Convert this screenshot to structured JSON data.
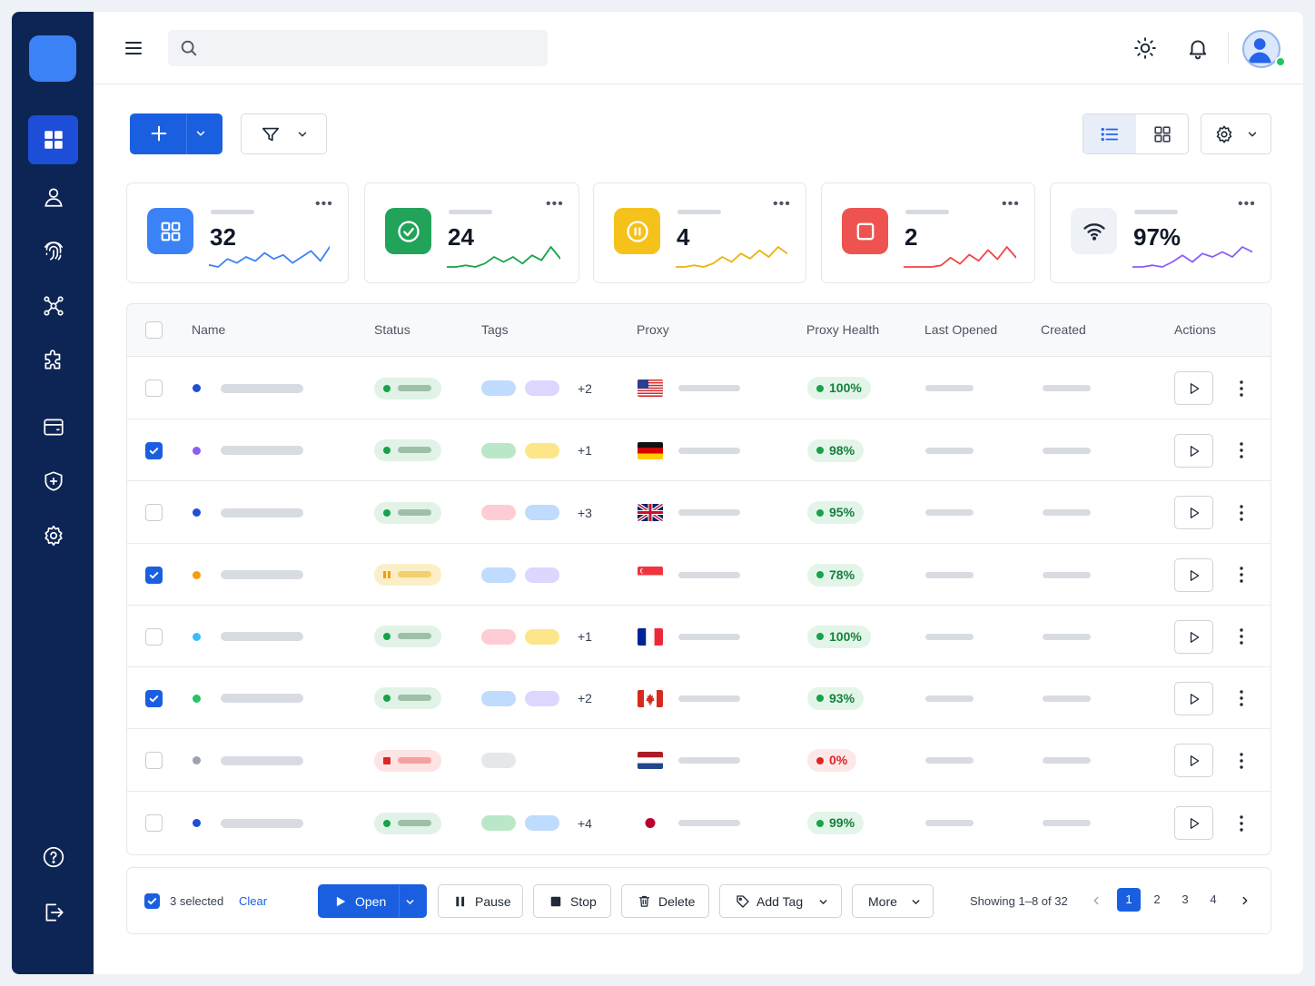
{
  "sidebar": {
    "items": [
      {
        "icon": "dashboard-icon",
        "active": true
      },
      {
        "icon": "user-icon"
      },
      {
        "icon": "fingerprint-icon"
      },
      {
        "icon": "network-icon"
      },
      {
        "icon": "puzzle-icon"
      },
      {
        "icon": "wallet-icon"
      },
      {
        "icon": "shield-plus-icon"
      },
      {
        "icon": "settings-icon"
      }
    ],
    "bottom": [
      {
        "icon": "help-icon"
      },
      {
        "icon": "logout-icon"
      }
    ]
  },
  "topbar": {
    "search_placeholder": ""
  },
  "stats": [
    {
      "value": "32",
      "icon": "grid-icon",
      "color": "#3b82f6",
      "spark": [
        4,
        3,
        7,
        5,
        8,
        6,
        10,
        7,
        9,
        5,
        8,
        11,
        6,
        13
      ]
    },
    {
      "value": "24",
      "icon": "check-circle-icon",
      "color": "#16a34a",
      "spark": [
        3,
        3,
        4,
        3,
        5,
        9,
        6,
        9,
        5,
        10,
        7,
        15,
        8
      ]
    },
    {
      "value": "4",
      "icon": "pause-circle-icon",
      "color": "#eab308",
      "spark": [
        3,
        3,
        4,
        3,
        5,
        9,
        6,
        11,
        8,
        13,
        9,
        15,
        11
      ]
    },
    {
      "value": "2",
      "icon": "stop-icon",
      "color": "#ef4444",
      "spark": [
        3,
        3,
        3,
        3,
        4,
        9,
        5,
        11,
        7,
        14,
        8,
        16,
        9
      ]
    },
    {
      "value": "97%",
      "icon": "wifi-icon",
      "color": "#8b5cf6",
      "spark": [
        3,
        3,
        4,
        3,
        6,
        10,
        6,
        11,
        9,
        12,
        9,
        15,
        12
      ]
    }
  ],
  "table": {
    "columns": [
      "Name",
      "Status",
      "Tags",
      "Proxy",
      "Proxy Health",
      "Last Opened",
      "Created",
      "Actions"
    ],
    "rows": [
      {
        "checked": false,
        "dot": "#1d4ed8",
        "status": "running",
        "tags": [
          "#bfdbfe",
          "#ddd6fe"
        ],
        "more": "+2",
        "flag": "us",
        "health": "100%",
        "bad": false
      },
      {
        "checked": true,
        "dot": "#8b5cf6",
        "status": "running",
        "tags": [
          "#bbe7c9",
          "#fde68a"
        ],
        "more": "+1",
        "flag": "de",
        "health": "98%",
        "bad": false
      },
      {
        "checked": false,
        "dot": "#1d4ed8",
        "status": "running",
        "tags": [
          "#fecdd3",
          "#bfdbfe"
        ],
        "more": "+3",
        "flag": "gb",
        "health": "95%",
        "bad": false
      },
      {
        "checked": true,
        "dot": "#f59e0b",
        "status": "paused",
        "tags": [
          "#bfdbfe",
          "#ddd6fe"
        ],
        "more": "",
        "flag": "sg",
        "health": "78%",
        "bad": false
      },
      {
        "checked": false,
        "dot": "#38bdf8",
        "status": "running",
        "tags": [
          "#fecdd3",
          "#fde68a"
        ],
        "more": "+1",
        "flag": "fr",
        "health": "100%",
        "bad": false
      },
      {
        "checked": true,
        "dot": "#22c55e",
        "status": "running",
        "tags": [
          "#bfdbfe",
          "#ddd6fe"
        ],
        "more": "+2",
        "flag": "ca",
        "health": "93%",
        "bad": false
      },
      {
        "checked": false,
        "dot": "#9ca3af",
        "status": "stopped",
        "tags": [
          "#e5e7eb"
        ],
        "more": "",
        "flag": "nl",
        "health": "0%",
        "bad": true
      },
      {
        "checked": false,
        "dot": "#1d4ed8",
        "status": "running",
        "tags": [
          "#bbe7c9",
          "#bfdbfe"
        ],
        "more": "+4",
        "flag": "jp",
        "health": "99%",
        "bad": false
      }
    ]
  },
  "footer": {
    "selected": "3 selected",
    "clear": "Clear",
    "open": "Open",
    "pause": "Pause",
    "stop": "Stop",
    "delete": "Delete",
    "add_tag": "Add Tag",
    "more": "More",
    "showing": "Showing 1–8 of 32",
    "pages": [
      "1",
      "2",
      "3",
      "4"
    ]
  }
}
